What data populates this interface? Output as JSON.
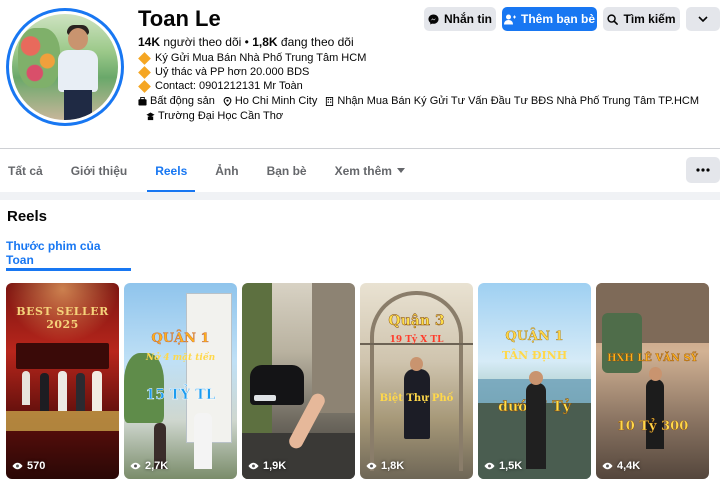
{
  "profile": {
    "name": "Toan Le",
    "followers_count": "14K",
    "followers_label": "người theo dõi",
    "following_count": "1,8K",
    "following_label": "đang theo dõi",
    "bio_lines": [
      "Ký Gửi Mua Bán Nhà Phố Trung Tâm HCM",
      "Uỷ thác và PP hơn 20.000 BDS",
      "Contact: 0901212131 Mr Toàn"
    ],
    "category": "Bất động sản",
    "location": "Ho Chi Minh City",
    "work": "Nhận Mua Bán Ký Gửi Tư Vấn Đầu Tư BĐS Nhà Phố Trung Tâm TP.HCM",
    "education": "Trường Đại Học Cần Thơ"
  },
  "actions": {
    "message": "Nhắn tin",
    "add_friend": "Thêm bạn bè",
    "search": "Tìm kiếm"
  },
  "tabs": [
    {
      "label": "Tất cả"
    },
    {
      "label": "Giới thiệu"
    },
    {
      "label": "Reels",
      "active": true
    },
    {
      "label": "Ảnh"
    },
    {
      "label": "Bạn bè"
    },
    {
      "label": "Xem thêm"
    }
  ],
  "reels_section": {
    "title": "Reels",
    "subtab": "Thước phim của Toan"
  },
  "reels": [
    {
      "views": "570",
      "text_top": "BEST SELLER 2025"
    },
    {
      "views": "2,7K",
      "text_top": "QUẬN 1",
      "text_mid": "Nở 4 mặt tiền",
      "text_low": "15 TỶ TL"
    },
    {
      "views": "1,9K"
    },
    {
      "views": "1,8K",
      "text_top": "Quận 3",
      "text_mid": "19 Tỷ X TL",
      "text_low": "Biệt Thự Phố"
    },
    {
      "views": "1,5K",
      "text_top": "QUẬN 1",
      "text_mid": "TÂN ĐỊNH",
      "text_low": "dưới 7 Tỷ"
    },
    {
      "views": "4,4K",
      "text_top": "HXH LÊ VĂN SỸ",
      "text_low": "10 Tỷ 300"
    }
  ],
  "colors": {
    "accent": "#1877f2",
    "button_grey": "#e4e6eb",
    "page_gap": "#f0f2f5"
  }
}
